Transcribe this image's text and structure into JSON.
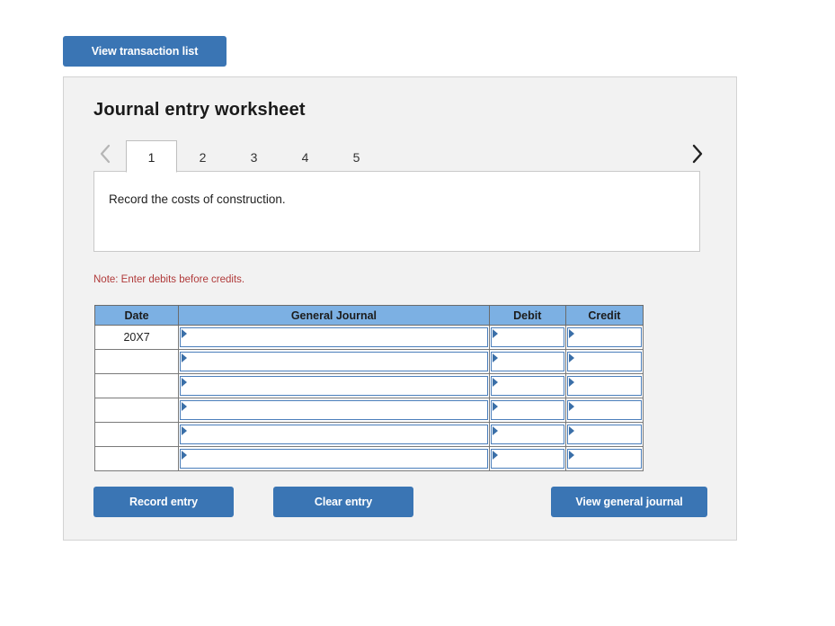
{
  "top": {
    "view_transaction_list_label": "View transaction list"
  },
  "panel": {
    "title": "Journal entry worksheet"
  },
  "tabs": {
    "prev_icon": "chevron-left-icon",
    "next_icon": "chevron-right-icon",
    "items": [
      {
        "label": "1",
        "active": true
      },
      {
        "label": "2",
        "active": false
      },
      {
        "label": "3",
        "active": false
      },
      {
        "label": "4",
        "active": false
      },
      {
        "label": "5",
        "active": false
      }
    ]
  },
  "description": {
    "text": "Record the costs of construction."
  },
  "note": {
    "text": "Note: Enter debits before credits."
  },
  "table": {
    "headers": [
      "Date",
      "General Journal",
      "Debit",
      "Credit"
    ],
    "rows": [
      {
        "date": "20X7",
        "general_journal": "",
        "debit": "",
        "credit": ""
      },
      {
        "date": "",
        "general_journal": "",
        "debit": "",
        "credit": ""
      },
      {
        "date": "",
        "general_journal": "",
        "debit": "",
        "credit": ""
      },
      {
        "date": "",
        "general_journal": "",
        "debit": "",
        "credit": ""
      },
      {
        "date": "",
        "general_journal": "",
        "debit": "",
        "credit": ""
      },
      {
        "date": "",
        "general_journal": "",
        "debit": "",
        "credit": ""
      }
    ]
  },
  "actions": {
    "record_entry_label": "Record entry",
    "clear_entry_label": "Clear entry",
    "view_general_journal_label": "View general journal"
  },
  "colors": {
    "button_blue": "#3a75b4",
    "header_blue": "#7cb0e3",
    "note_red": "#b03a3a",
    "panel_bg": "#f2f2f2",
    "cell_border_blue": "#4a7ebb"
  }
}
